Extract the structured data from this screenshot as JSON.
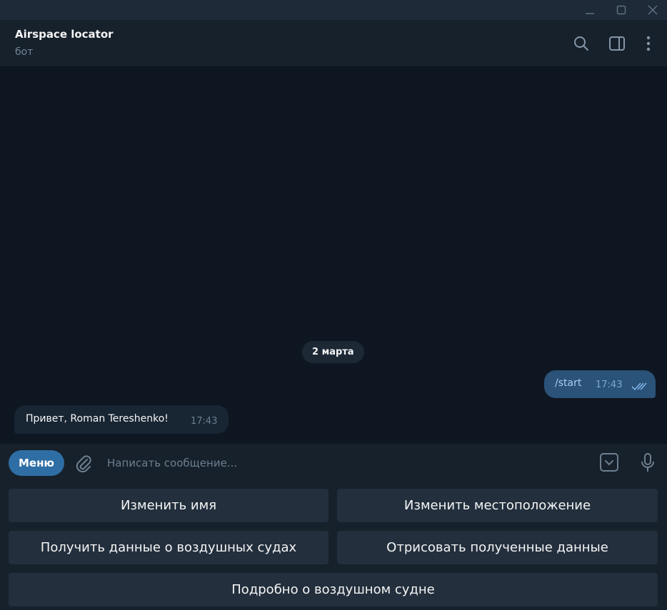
{
  "window": {
    "controls": [
      "minimize-icon",
      "maximize-icon",
      "close-icon"
    ]
  },
  "chat": {
    "title": "Airspace locator",
    "subtitle": "бот",
    "header_icons": [
      "search-icon",
      "sidebar-toggle-icon",
      "more-vertical-icon"
    ]
  },
  "messages": {
    "date_separator": "2 марта",
    "outgoing": [
      {
        "text": "/start",
        "time": "17:43",
        "status": "read"
      }
    ],
    "incoming": [
      {
        "text": "Привет, Roman Tereshenko!",
        "time": "17:43"
      }
    ]
  },
  "composer": {
    "menu_label": "Меню",
    "placeholder": "Написать сообщение...",
    "value": ""
  },
  "keyboard": {
    "rows": [
      [
        "Изменить имя",
        "Изменить местоположение"
      ],
      [
        "Получить данные о воздушных судах",
        "Отрисовать полученные данные"
      ],
      [
        "Подробно о воздушном судне"
      ]
    ]
  },
  "colors": {
    "background": "#0e1621",
    "panel": "#17212b",
    "accent": "#2f6ea5",
    "outgoing_bubble": "#2b5278",
    "incoming_bubble": "#182533",
    "keyboard_button": "#232f3d"
  }
}
